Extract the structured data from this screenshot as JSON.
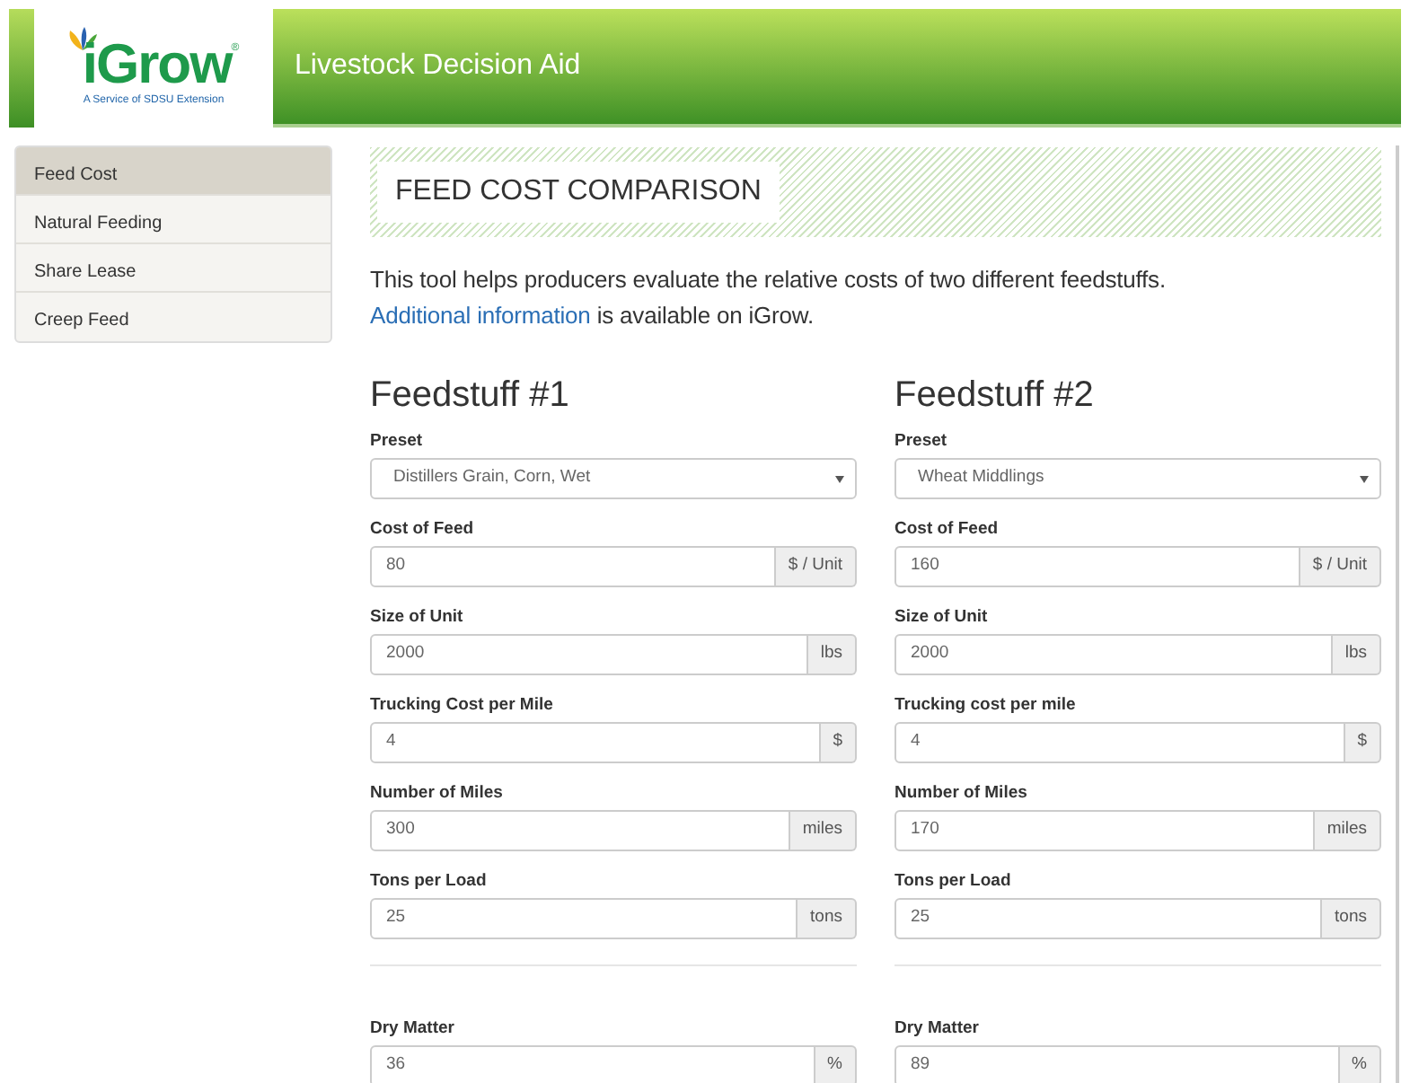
{
  "header": {
    "logo_text": "iGrow",
    "logo_mark": "®",
    "logo_tagline": "A Service of SDSU Extension",
    "title": "Livestock Decision Aid"
  },
  "sidebar": {
    "items": [
      {
        "label": "Feed Cost",
        "selected": true
      },
      {
        "label": "Natural Feeding",
        "selected": false
      },
      {
        "label": "Share Lease",
        "selected": false
      },
      {
        "label": "Creep Feed",
        "selected": false
      }
    ]
  },
  "section_title": "FEED COST COMPARISON",
  "intro": {
    "text": "This tool helps producers evaluate the relative costs of two different feedstuffs. ",
    "link": "Additional information",
    "after": " is available on iGrow."
  },
  "feedstuffs": [
    {
      "title": "Feedstuff #1",
      "preset": {
        "label": "Preset",
        "value": "Distillers Grain, Corn, Wet"
      },
      "fields": [
        {
          "label": "Cost of Feed",
          "value": "80",
          "unit": "$ / Unit"
        },
        {
          "label": "Size of Unit",
          "value": "2000",
          "unit": "lbs"
        },
        {
          "label": "Trucking Cost per Mile",
          "value": "4",
          "unit": "$"
        },
        {
          "label": "Number of Miles",
          "value": "300",
          "unit": "miles"
        },
        {
          "label": "Tons per Load",
          "value": "25",
          "unit": "tons"
        }
      ],
      "extra_fields": [
        {
          "label": "Dry Matter",
          "value": "36",
          "unit": "%"
        }
      ]
    },
    {
      "title": "Feedstuff #2",
      "preset": {
        "label": "Preset",
        "value": "Wheat Middlings"
      },
      "fields": [
        {
          "label": "Cost of Feed",
          "value": "160",
          "unit": "$ / Unit"
        },
        {
          "label": "Size of Unit",
          "value": "2000",
          "unit": "lbs"
        },
        {
          "label": "Trucking cost per mile",
          "value": "4",
          "unit": "$"
        },
        {
          "label": "Number of Miles",
          "value": "170",
          "unit": "miles"
        },
        {
          "label": "Tons per Load",
          "value": "25",
          "unit": "tons"
        }
      ],
      "extra_fields": [
        {
          "label": "Dry Matter",
          "value": "89",
          "unit": "%"
        }
      ]
    }
  ]
}
